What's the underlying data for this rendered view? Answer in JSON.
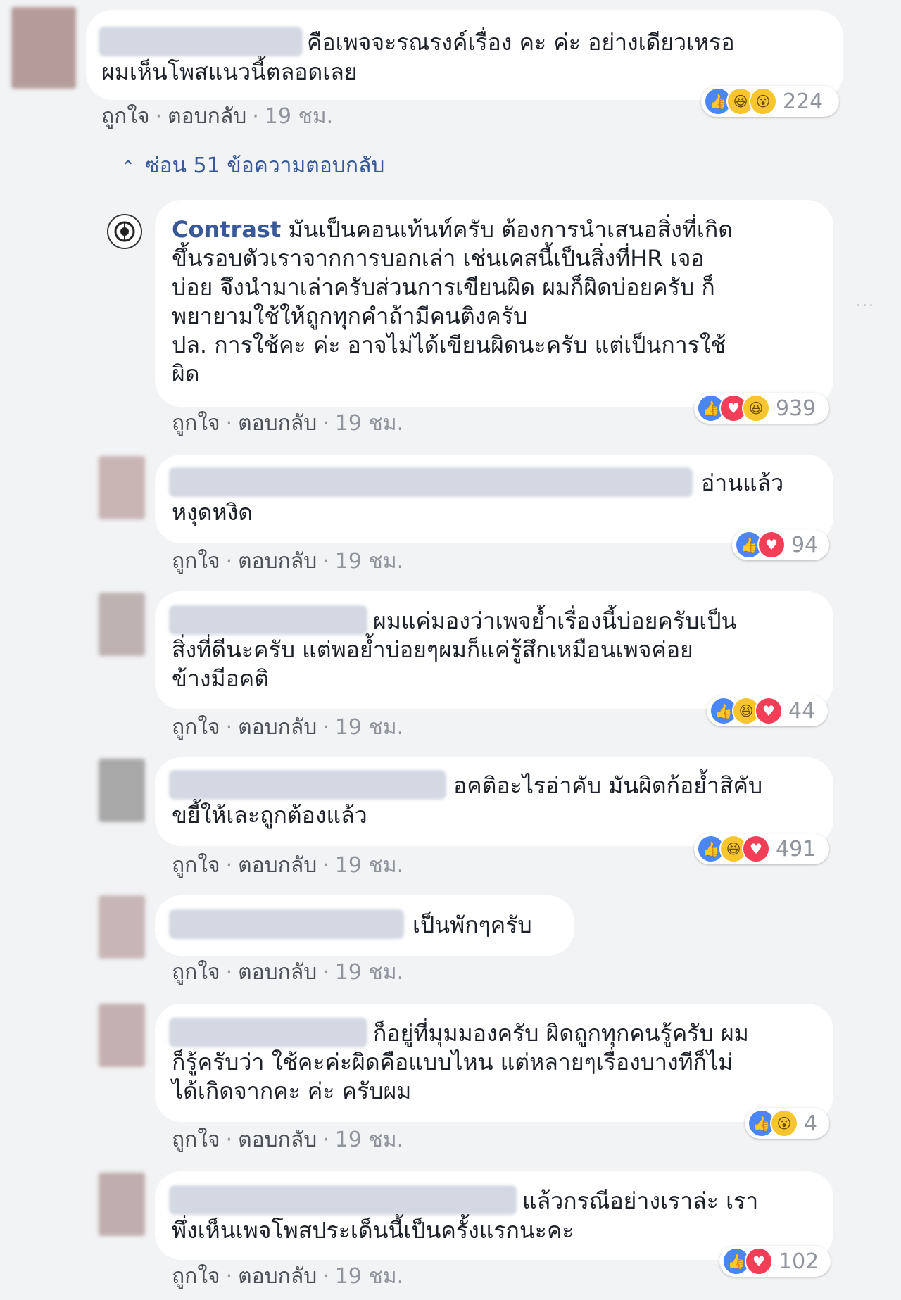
{
  "comments": [
    {
      "lines": [
        "คือเพจจะรณรงค์เรื่อง คะ ค่ะ อย่างเดียวเหรอ",
        "ผมเห็นโพสแนวนี้ตลอดเลย"
      ],
      "actions": {
        "like": "ถูกใจ",
        "reply": "ตอบกลับ",
        "time": "19 ชม."
      },
      "reactions": {
        "icons": [
          "like-icon",
          "haha-icon",
          "wow-icon"
        ],
        "count": "224"
      }
    }
  ],
  "hide_replies": "ซ่อน 51 ข้อความตอบกลับ",
  "replies": [
    {
      "author": "Contrast",
      "lines": [
        "มันเป็นคอนเท้นท์ครับ ต้องการนำเสนอสิ่งที่เกิด",
        "ขึ้นรอบตัวเราจากการบอกเล่า เช่นเคสนี้เป็นสิ่งที่HR เจอ",
        "บ่อย จึงนำมาเล่าครับส่วนการเขียนผิด ผมก็ผิดบ่อยครับ ก็",
        "พยายามใช้ให้ถูกทุกคำถ้ามีคนติงครับ",
        "ปล. การใช้คะ ค่ะ อาจไม่ได้เขียนผิดนะครับ แต่เป็นการใช้",
        "ผิด"
      ],
      "actions": {
        "like": "ถูกใจ",
        "reply": "ตอบกลับ",
        "time": "19 ชม."
      },
      "reactions": {
        "icons": [
          "like-icon",
          "love-icon",
          "haha-icon"
        ],
        "count": "939"
      }
    },
    {
      "lines": [
        "อ่านแล้ว",
        "หงุดหงิด"
      ],
      "actions": {
        "like": "ถูกใจ",
        "reply": "ตอบกลับ",
        "time": "19 ชม."
      },
      "reactions": {
        "icons": [
          "like-icon",
          "love-icon"
        ],
        "count": "94"
      }
    },
    {
      "lines": [
        "ผมแค่มองว่าเพจย้ำเรื่องนี้บ่อยครับเป็น",
        "สิ่งที่ดีนะครับ แต่พอย้ำบ่อยๆผมก็แค่รู้สึกเหมือนเพจค่อย",
        "ข้างมีอคติ"
      ],
      "actions": {
        "like": "ถูกใจ",
        "reply": "ตอบกลับ",
        "time": "19 ชม."
      },
      "reactions": {
        "icons": [
          "like-icon",
          "haha-icon",
          "love-icon"
        ],
        "count": "44"
      }
    },
    {
      "lines": [
        "อคติอะไรอ่าคับ มันผิดก้อย้ำสิคับ",
        "ขยี้ให้เละถูกต้องแล้ว"
      ],
      "actions": {
        "like": "ถูกใจ",
        "reply": "ตอบกลับ",
        "time": "19 ชม."
      },
      "reactions": {
        "icons": [
          "like-icon",
          "haha-icon",
          "love-icon"
        ],
        "count": "491"
      }
    },
    {
      "lines": [
        "เป็นพักๆครับ"
      ],
      "actions": {
        "like": "ถูกใจ",
        "reply": "ตอบกลับ",
        "time": "19 ชม."
      }
    },
    {
      "lines": [
        "ก็อยู่ที่มุมมองครับ ผิดถูกทุกคนรู้ครับ ผม",
        "ก็รู้ครับว่า ใช้คะค่ะผิดคือแบบไหน แต่หลายๆเรื่องบางทีก็ไม่",
        "ได้เกิดจากคะ ค่ะ ครับผม"
      ],
      "actions": {
        "like": "ถูกใจ",
        "reply": "ตอบกลับ",
        "time": "19 ชม."
      },
      "reactions": {
        "icons": [
          "like-icon",
          "wow-icon"
        ],
        "count": "4"
      }
    },
    {
      "lines": [
        "แล้วกรณีอย่างเราล่ะ เรา",
        "พึ่งเห็นเพจโพสประเด็นนี้เป็นครั้งแรกนะคะ"
      ],
      "actions": {
        "like": "ถูกใจ",
        "reply": "ตอบกลับ",
        "time": "19 ชม."
      },
      "reactions": {
        "icons": [
          "like-icon",
          "love-icon"
        ],
        "count": "102"
      }
    }
  ],
  "more_options": "...",
  "colors": {
    "link": "#385898",
    "bubble": "#ffffff",
    "background": "#f2f3f5",
    "meta": "#90949c"
  }
}
